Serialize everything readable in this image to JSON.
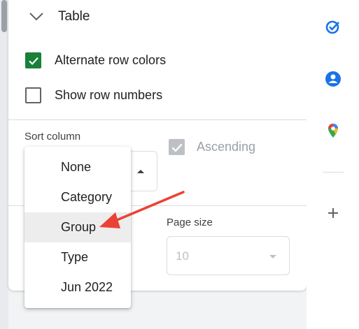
{
  "table_section": {
    "title": "Table",
    "alternate_row_colors": {
      "label": "Alternate row colors",
      "checked": true
    },
    "show_row_numbers": {
      "label": "Show row numbers",
      "checked": false
    }
  },
  "sort": {
    "label": "Sort column",
    "ascending": {
      "label": "Ascending",
      "checked": true,
      "disabled": true
    }
  },
  "dropdown": {
    "options": [
      "None",
      "Category",
      "Group",
      "Type",
      "Jun 2022"
    ],
    "highlighted": "Group"
  },
  "page_size": {
    "label": "Page size",
    "value": "10"
  },
  "side_panel": {
    "icons": [
      "tasks-icon",
      "contacts-icon",
      "maps-icon",
      "add-icon"
    ]
  },
  "colors": {
    "checkbox_checked": "#188038",
    "annotation_arrow": "#ea4335",
    "tasks_blue": "#1a73e8"
  }
}
